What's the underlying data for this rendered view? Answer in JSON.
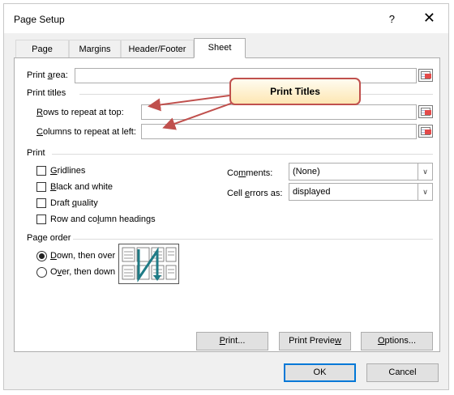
{
  "window": {
    "title": "Page Setup",
    "help_glyph": "?",
    "close_glyph": "✕"
  },
  "tabs": [
    {
      "label": "Page",
      "active": false
    },
    {
      "label": "Margins",
      "active": false
    },
    {
      "label": "Header/Footer",
      "active": false
    },
    {
      "label": "Sheet",
      "active": true
    }
  ],
  "print_area": {
    "pre": "Print ",
    "key": "a",
    "post": "rea:",
    "value": ""
  },
  "print_titles": {
    "header": "Print titles",
    "rows": {
      "key": "R",
      "post": "ows to repeat at top:",
      "value": ""
    },
    "columns": {
      "key": "C",
      "post": "olumns to repeat at left:",
      "value": ""
    }
  },
  "print": {
    "header": "Print",
    "gridlines": {
      "key": "G",
      "post": "ridlines",
      "checked": false
    },
    "black_white": {
      "key": "B",
      "post": "lack and white",
      "checked": false
    },
    "draft": {
      "pre": "Draft ",
      "key": "q",
      "post": "uality",
      "checked": false
    },
    "headings": {
      "pre": "Row and co",
      "key": "l",
      "post": "umn headings",
      "checked": false
    },
    "comments": {
      "pre": "Co",
      "key": "m",
      "post": "ments:",
      "value": "(None)"
    },
    "cell_errors": {
      "pre": "Cell ",
      "key": "e",
      "post": "rrors as:",
      "value": "displayed"
    }
  },
  "page_order": {
    "header": "Page order",
    "down_then_over": {
      "key": "D",
      "post": "own, then over",
      "selected": true
    },
    "over_then_down": {
      "pre": "O",
      "key": "v",
      "post": "er, then down",
      "selected": false
    }
  },
  "buttons": {
    "print": {
      "key": "P",
      "post": "rint..."
    },
    "preview": {
      "pre": "Print Previe",
      "key": "w",
      "post": ""
    },
    "options": {
      "key": "O",
      "post": "ptions..."
    },
    "ok": "OK",
    "cancel": "Cancel"
  },
  "annotation": {
    "label": "Print Titles",
    "border_color": "#c0504d"
  },
  "colors": {
    "accent": "#0078d7",
    "annotation": "#c0504d"
  },
  "icons": [
    "collapse-dialog-icon",
    "dropdown-arrow-icon",
    "page-order-icon",
    "close-icon"
  ]
}
